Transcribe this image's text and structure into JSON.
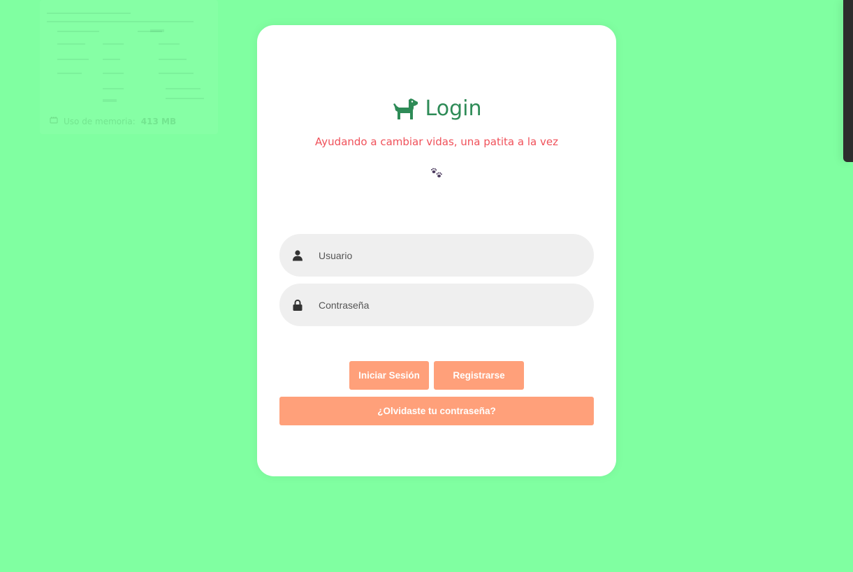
{
  "background_color": "#80ffa1",
  "ghost_panel": {
    "memory_label": "Uso de memoria:",
    "memory_value": "413 MB",
    "icon": "memory-icon"
  },
  "login": {
    "icon": "dog-icon",
    "title": "Login",
    "subtitle": "Ayudando a cambiar vidas, una patita a la vez",
    "decor_icon": "paws-icon",
    "username": {
      "icon": "user-icon",
      "placeholder": "Usuario",
      "value": ""
    },
    "password": {
      "icon": "lock-icon",
      "placeholder": "Contraseña",
      "value": ""
    },
    "buttons": {
      "login": "Iniciar Sesión",
      "register": "Registrarse",
      "forgot": "¿Olvidaste tu contraseña?"
    },
    "colors": {
      "title": "#2e8b57",
      "subtitle": "#f0515a",
      "button": "#ffa07a",
      "field": "#efefef"
    }
  }
}
